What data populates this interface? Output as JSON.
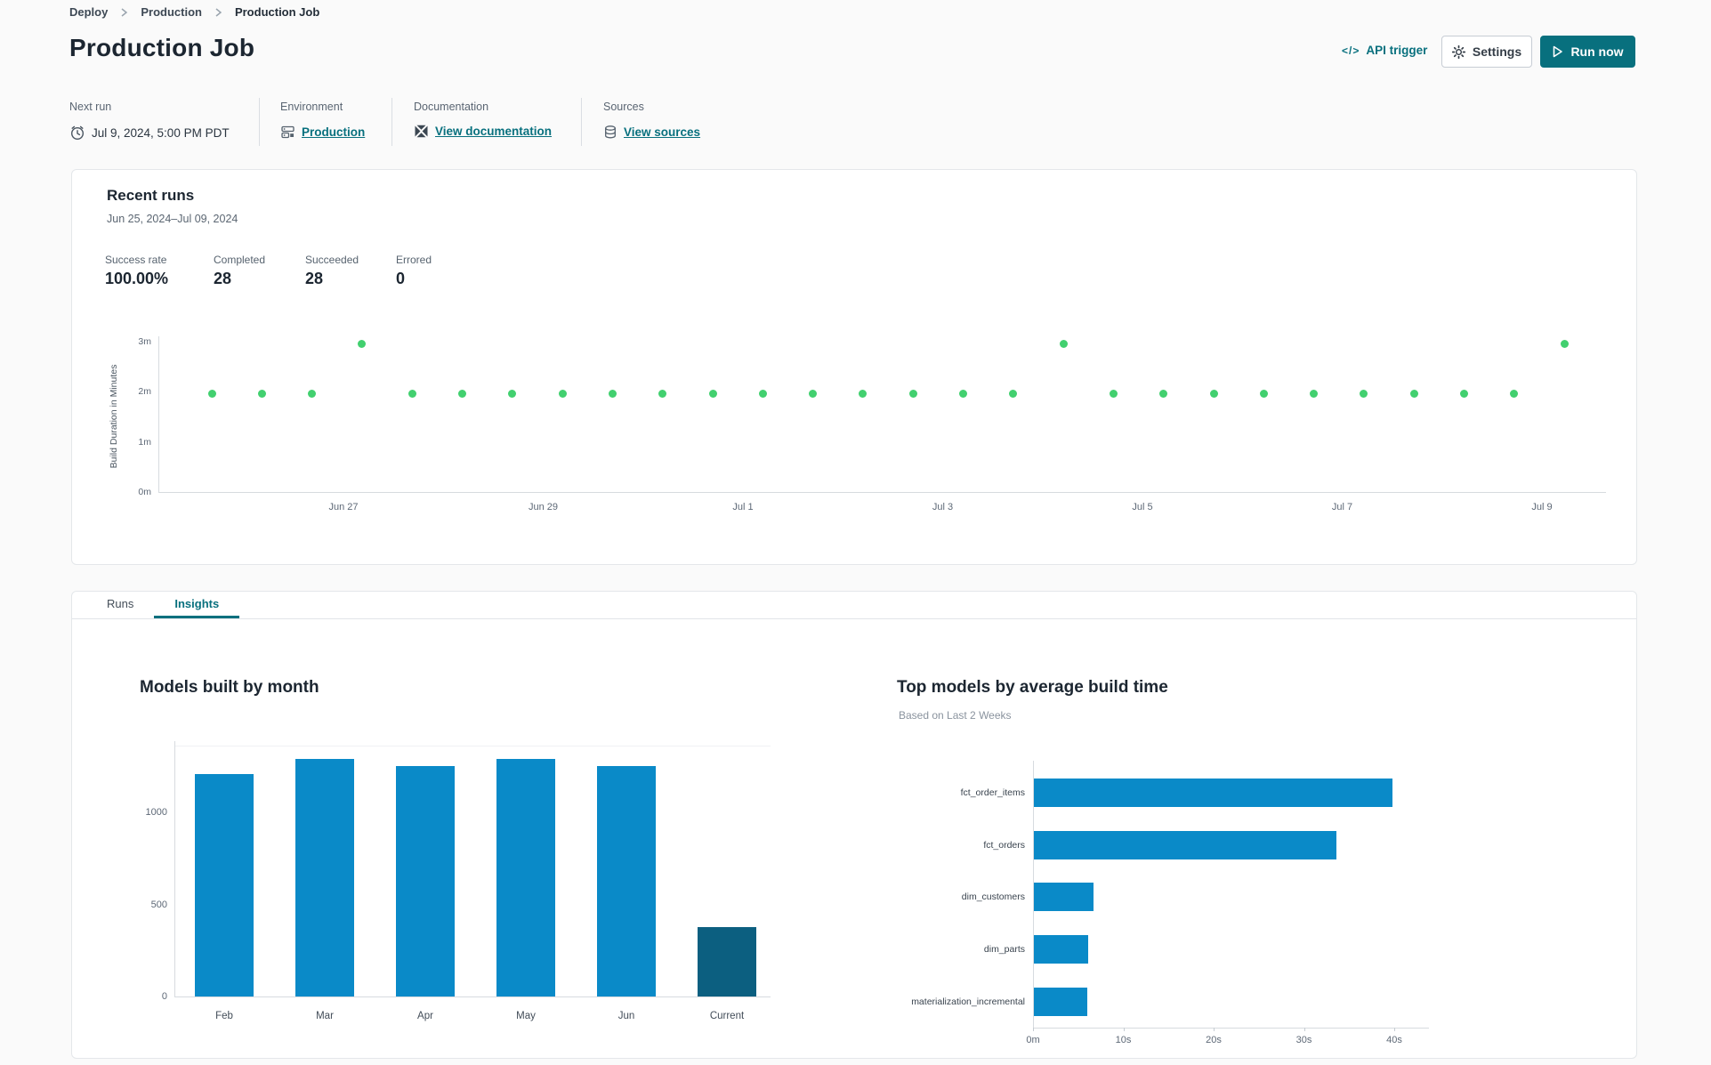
{
  "app": {
    "accent": "#08707e"
  },
  "breadcrumb": {
    "items": [
      "Deploy",
      "Production",
      "Production Job"
    ]
  },
  "header": {
    "title": "Production Job",
    "api_trigger_label": "API trigger",
    "settings_label": "Settings",
    "run_now_label": "Run now"
  },
  "meta": {
    "next_run": {
      "label": "Next run",
      "value": "Jul 9, 2024, 5:00 PM PDT"
    },
    "environment": {
      "label": "Environment",
      "link": "Production"
    },
    "documentation": {
      "label": "Documentation",
      "link": "View documentation"
    },
    "sources": {
      "label": "Sources",
      "link": "View sources"
    }
  },
  "recent_runs": {
    "title": "Recent runs",
    "date_range": "Jun 25, 2024–Jul 09, 2024",
    "stats": [
      {
        "label": "Success rate",
        "value": "100.00%"
      },
      {
        "label": "Completed",
        "value": "28"
      },
      {
        "label": "Succeeded",
        "value": "28"
      },
      {
        "label": "Errored",
        "value": "0"
      }
    ]
  },
  "tabs": [
    {
      "label": "Runs",
      "active": false
    },
    {
      "label": "Insights",
      "active": true
    }
  ],
  "chart_data": [
    {
      "type": "scatter",
      "name": "recent-runs-build-duration",
      "ylabel": "Build Duration in Minutes",
      "ylim": [
        0,
        3.2
      ],
      "y_ticks": [
        {
          "value": 0,
          "label": "0m"
        },
        {
          "value": 1,
          "label": "1m"
        },
        {
          "value": 2,
          "label": "2m"
        },
        {
          "value": 3,
          "label": "3m"
        }
      ],
      "x_ticks": [
        "Jun 27",
        "Jun 29",
        "Jul 1",
        "Jul 3",
        "Jul 5",
        "Jul 7",
        "Jul 9"
      ],
      "point_color": "#42d06f",
      "values": [
        1.95,
        1.95,
        1.95,
        2.95,
        1.95,
        1.95,
        1.95,
        1.95,
        1.95,
        1.95,
        1.95,
        1.95,
        1.95,
        1.95,
        1.95,
        1.95,
        1.95,
        2.95,
        1.95,
        1.95,
        1.95,
        1.95,
        1.95,
        1.95,
        1.95,
        1.95,
        1.95,
        2.95
      ]
    },
    {
      "type": "bar",
      "title": "Models built by month",
      "categories": [
        "Feb",
        "Mar",
        "Apr",
        "May",
        "Jun",
        "Current"
      ],
      "values": [
        1210,
        1290,
        1250,
        1290,
        1250,
        375
      ],
      "y_ticks": [
        0,
        500,
        1000
      ],
      "ylim": [
        0,
        1400
      ],
      "bar_color": "#0a8ac8",
      "highlight_color": "#0c5f80",
      "highlight_category": "Current"
    },
    {
      "type": "bar-horizontal",
      "title": "Top models by average build time",
      "subtitle": "Based on Last 2 Weeks",
      "categories": [
        "fct_order_items",
        "fct_orders",
        "dim_customers",
        "dim_parts",
        "materialization_incremental"
      ],
      "values_seconds": [
        39.7,
        33.5,
        6.6,
        6.0,
        5.9
      ],
      "x_ticks": [
        {
          "value": 0,
          "label": "0m"
        },
        {
          "value": 10,
          "label": "10s"
        },
        {
          "value": 20,
          "label": "20s"
        },
        {
          "value": 30,
          "label": "30s"
        },
        {
          "value": 40,
          "label": "40s"
        }
      ],
      "xlim": [
        0,
        44
      ],
      "bar_color": "#0a8ac8"
    }
  ]
}
